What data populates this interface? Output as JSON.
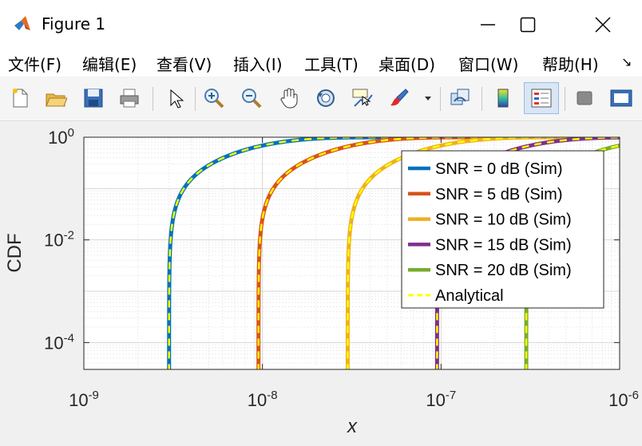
{
  "window": {
    "title": "Figure 1"
  },
  "menu": [
    "文件(F)",
    "编辑(E)",
    "查看(V)",
    "插入(I)",
    "工具(T)",
    "桌面(D)",
    "窗口(W)",
    "帮助(H)"
  ],
  "toolbar": {
    "icons": [
      "new-figure-icon",
      "open-file-icon",
      "save-icon",
      "print-icon",
      "select-arrow-icon",
      "zoom-in-icon",
      "zoom-out-icon",
      "pan-hand-icon",
      "rotate-3d-icon",
      "data-cursor-icon",
      "brush-icon",
      "link-plot-icon",
      "colorbar-icon",
      "legend-icon",
      "hide-plot-tools-icon",
      "show-plot-tools-icon"
    ]
  },
  "chart_data": {
    "type": "line",
    "xlabel": "x",
    "ylabel": "CDF",
    "xscale": "log",
    "yscale": "log",
    "xlim": [
      1e-09,
      1e-06
    ],
    "ylim": [
      3e-05,
      1
    ],
    "x_ticks": [
      {
        "value": 1e-09,
        "base": "10",
        "exp": "-9"
      },
      {
        "value": 1e-08,
        "base": "10",
        "exp": "-8"
      },
      {
        "value": 1e-07,
        "base": "10",
        "exp": "-7"
      },
      {
        "value": 1e-06,
        "base": "10",
        "exp": "-6"
      }
    ],
    "y_ticks": [
      {
        "value": 1,
        "base": "10",
        "exp": "0"
      },
      {
        "value": 0.01,
        "base": "10",
        "exp": "-2"
      },
      {
        "value": 0.0001,
        "base": "10",
        "exp": "-4"
      }
    ],
    "grid": true,
    "legend_position": "top-right",
    "series": [
      {
        "name": "SNR = 0 dB (Sim)",
        "color": "#0072bd",
        "x0": 3e-09,
        "scale": 6e-09
      },
      {
        "name": "SNR = 5 dB (Sim)",
        "color": "#d95319",
        "x0": 9.5e-09,
        "scale": 1.9e-08
      },
      {
        "name": "SNR = 10 dB (Sim)",
        "color": "#edb120",
        "x0": 3e-08,
        "scale": 6e-08
      },
      {
        "name": "SNR = 15 dB (Sim)",
        "color": "#7e2f8e",
        "x0": 9.5e-08,
        "scale": 1.9e-07
      },
      {
        "name": "SNR = 20 dB (Sim)",
        "color": "#77ac30",
        "x0": 3e-07,
        "scale": 6e-07
      }
    ],
    "analytical": {
      "name": "Analytical",
      "color": "#ffff00",
      "style": "dashed"
    }
  }
}
